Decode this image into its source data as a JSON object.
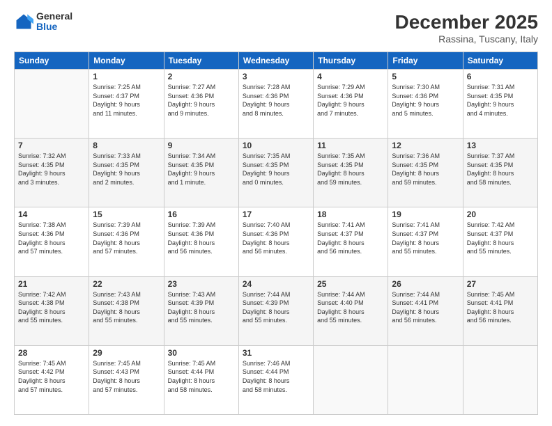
{
  "header": {
    "logo_general": "General",
    "logo_blue": "Blue",
    "month_title": "December 2025",
    "subtitle": "Rassina, Tuscany, Italy"
  },
  "calendar": {
    "days_of_week": [
      "Sunday",
      "Monday",
      "Tuesday",
      "Wednesday",
      "Thursday",
      "Friday",
      "Saturday"
    ],
    "weeks": [
      [
        {
          "day": "",
          "info": ""
        },
        {
          "day": "1",
          "info": "Sunrise: 7:25 AM\nSunset: 4:37 PM\nDaylight: 9 hours\nand 11 minutes."
        },
        {
          "day": "2",
          "info": "Sunrise: 7:27 AM\nSunset: 4:36 PM\nDaylight: 9 hours\nand 9 minutes."
        },
        {
          "day": "3",
          "info": "Sunrise: 7:28 AM\nSunset: 4:36 PM\nDaylight: 9 hours\nand 8 minutes."
        },
        {
          "day": "4",
          "info": "Sunrise: 7:29 AM\nSunset: 4:36 PM\nDaylight: 9 hours\nand 7 minutes."
        },
        {
          "day": "5",
          "info": "Sunrise: 7:30 AM\nSunset: 4:36 PM\nDaylight: 9 hours\nand 5 minutes."
        },
        {
          "day": "6",
          "info": "Sunrise: 7:31 AM\nSunset: 4:35 PM\nDaylight: 9 hours\nand 4 minutes."
        }
      ],
      [
        {
          "day": "7",
          "info": "Sunrise: 7:32 AM\nSunset: 4:35 PM\nDaylight: 9 hours\nand 3 minutes."
        },
        {
          "day": "8",
          "info": "Sunrise: 7:33 AM\nSunset: 4:35 PM\nDaylight: 9 hours\nand 2 minutes."
        },
        {
          "day": "9",
          "info": "Sunrise: 7:34 AM\nSunset: 4:35 PM\nDaylight: 9 hours\nand 1 minute."
        },
        {
          "day": "10",
          "info": "Sunrise: 7:35 AM\nSunset: 4:35 PM\nDaylight: 9 hours\nand 0 minutes."
        },
        {
          "day": "11",
          "info": "Sunrise: 7:35 AM\nSunset: 4:35 PM\nDaylight: 8 hours\nand 59 minutes."
        },
        {
          "day": "12",
          "info": "Sunrise: 7:36 AM\nSunset: 4:35 PM\nDaylight: 8 hours\nand 59 minutes."
        },
        {
          "day": "13",
          "info": "Sunrise: 7:37 AM\nSunset: 4:35 PM\nDaylight: 8 hours\nand 58 minutes."
        }
      ],
      [
        {
          "day": "14",
          "info": "Sunrise: 7:38 AM\nSunset: 4:36 PM\nDaylight: 8 hours\nand 57 minutes."
        },
        {
          "day": "15",
          "info": "Sunrise: 7:39 AM\nSunset: 4:36 PM\nDaylight: 8 hours\nand 57 minutes."
        },
        {
          "day": "16",
          "info": "Sunrise: 7:39 AM\nSunset: 4:36 PM\nDaylight: 8 hours\nand 56 minutes."
        },
        {
          "day": "17",
          "info": "Sunrise: 7:40 AM\nSunset: 4:36 PM\nDaylight: 8 hours\nand 56 minutes."
        },
        {
          "day": "18",
          "info": "Sunrise: 7:41 AM\nSunset: 4:37 PM\nDaylight: 8 hours\nand 56 minutes."
        },
        {
          "day": "19",
          "info": "Sunrise: 7:41 AM\nSunset: 4:37 PM\nDaylight: 8 hours\nand 55 minutes."
        },
        {
          "day": "20",
          "info": "Sunrise: 7:42 AM\nSunset: 4:37 PM\nDaylight: 8 hours\nand 55 minutes."
        }
      ],
      [
        {
          "day": "21",
          "info": "Sunrise: 7:42 AM\nSunset: 4:38 PM\nDaylight: 8 hours\nand 55 minutes."
        },
        {
          "day": "22",
          "info": "Sunrise: 7:43 AM\nSunset: 4:38 PM\nDaylight: 8 hours\nand 55 minutes."
        },
        {
          "day": "23",
          "info": "Sunrise: 7:43 AM\nSunset: 4:39 PM\nDaylight: 8 hours\nand 55 minutes."
        },
        {
          "day": "24",
          "info": "Sunrise: 7:44 AM\nSunset: 4:39 PM\nDaylight: 8 hours\nand 55 minutes."
        },
        {
          "day": "25",
          "info": "Sunrise: 7:44 AM\nSunset: 4:40 PM\nDaylight: 8 hours\nand 55 minutes."
        },
        {
          "day": "26",
          "info": "Sunrise: 7:44 AM\nSunset: 4:41 PM\nDaylight: 8 hours\nand 56 minutes."
        },
        {
          "day": "27",
          "info": "Sunrise: 7:45 AM\nSunset: 4:41 PM\nDaylight: 8 hours\nand 56 minutes."
        }
      ],
      [
        {
          "day": "28",
          "info": "Sunrise: 7:45 AM\nSunset: 4:42 PM\nDaylight: 8 hours\nand 57 minutes."
        },
        {
          "day": "29",
          "info": "Sunrise: 7:45 AM\nSunset: 4:43 PM\nDaylight: 8 hours\nand 57 minutes."
        },
        {
          "day": "30",
          "info": "Sunrise: 7:45 AM\nSunset: 4:44 PM\nDaylight: 8 hours\nand 58 minutes."
        },
        {
          "day": "31",
          "info": "Sunrise: 7:46 AM\nSunset: 4:44 PM\nDaylight: 8 hours\nand 58 minutes."
        },
        {
          "day": "",
          "info": ""
        },
        {
          "day": "",
          "info": ""
        },
        {
          "day": "",
          "info": ""
        }
      ]
    ]
  }
}
